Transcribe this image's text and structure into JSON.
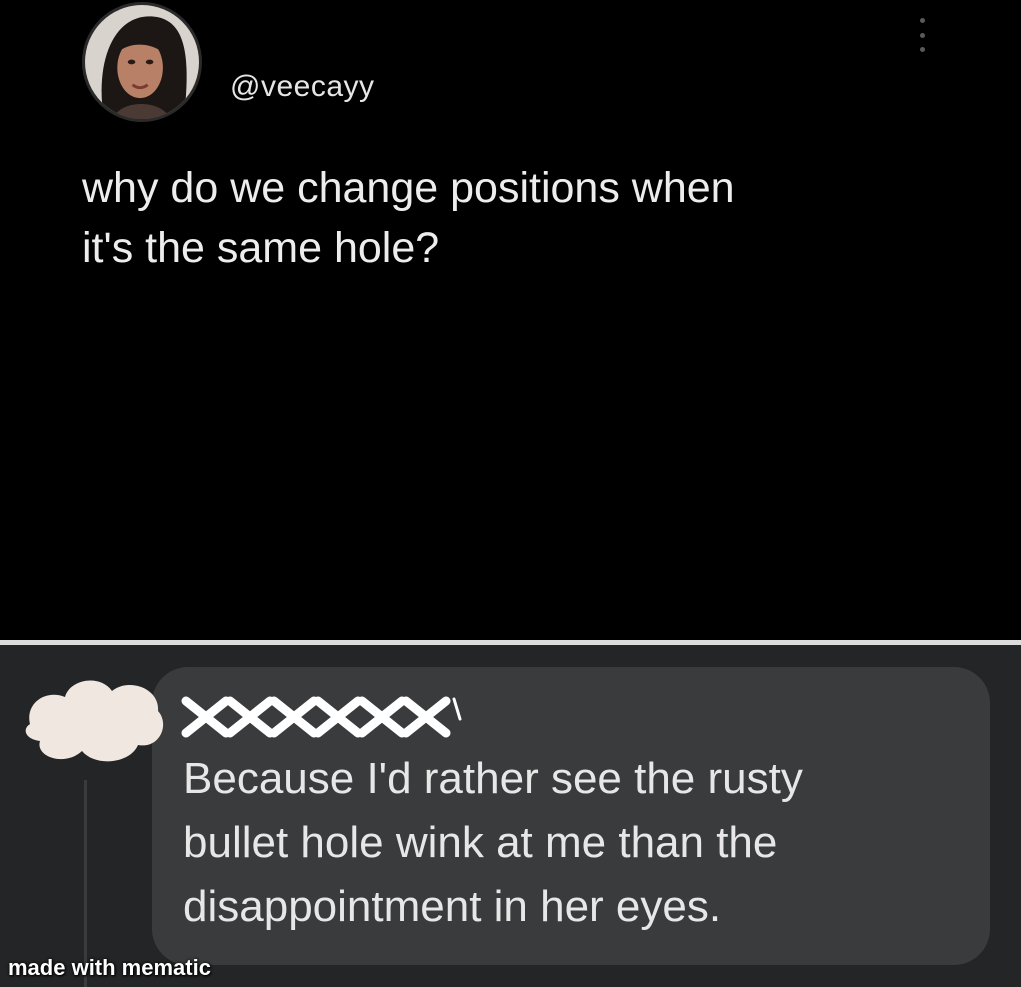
{
  "tweet": {
    "handle": "@veecayy",
    "text_lines": [
      "why do we change positions when",
      "it's the same hole?"
    ]
  },
  "comment": {
    "text_lines": [
      "Because I'd rather see the rusty",
      "bullet hole wink at me than the",
      "disappointment in her eyes."
    ]
  },
  "watermark": "made with mematic",
  "colors": {
    "tweet_background": "#000000",
    "comment_panel_background": "#242526",
    "comment_bubble": "#3a3b3c",
    "divider": "#dcdcdc"
  },
  "icons": {
    "more": "vertical-ellipsis",
    "avatar": "profile-photo",
    "redaction": "scribble"
  }
}
